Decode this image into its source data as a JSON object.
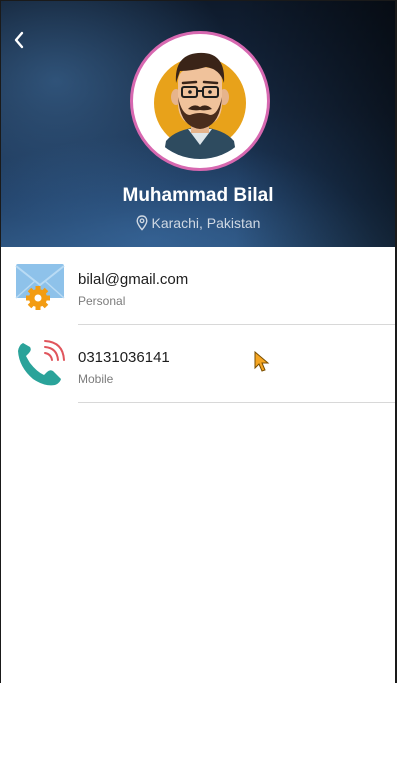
{
  "profile": {
    "name": "Muhammad Bilal",
    "location": "Karachi, Pakistan"
  },
  "contacts": [
    {
      "value": "bilal@gmail.com",
      "type": "Personal",
      "icon": "email-settings-icon"
    },
    {
      "value": "03131036141",
      "type": "Mobile",
      "icon": "phone-icon"
    }
  ],
  "colors": {
    "avatar_ring": "#d768b0",
    "avatar_bg": "#e8a21a",
    "phone_green": "#2aa39a",
    "phone_waves": "#e0555c",
    "gear_orange": "#f39c12"
  }
}
